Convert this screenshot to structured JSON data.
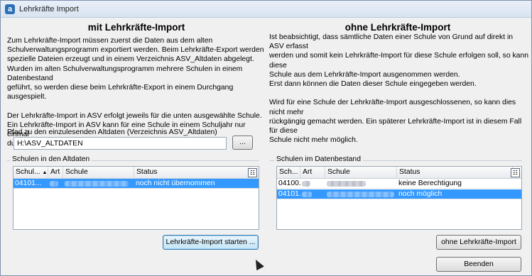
{
  "window": {
    "title": "Lehrkräfte Import",
    "app_icon": "a"
  },
  "left": {
    "heading": "mit Lehrkräfte-Import",
    "description": "Zum Lehrkräfte-Import müssen zuerst die Daten aus dem alten\nSchulverwaltungsprogramm exportiert werden. Beim Lehrkräfte-Export werden\nspezielle Dateien erzeugt und in einem Verzeichnis ASV_Altdaten abgelegt.\nWurden im alten Schulverwaltungsprogramm mehrere Schulen in einem Datenbestand\ngeführt, so werden diese beim Lehrkräfte-Export in einem Durchgang ausgespielt.\n\nDer Lehrkräfte-Import in ASV erfolgt jeweils für die unten ausgewählte Schule.\nEin Lehrkräfte-Import in ASV kann für eine Schule in einem Schuljahr nur einmal\ndurchgeführt werden.",
    "path_label": "Pfad zu den einzulesenden Altdaten (Verzeichnis ASV_Altdaten)",
    "path_value": "H:\\ASV_ALTDATEN",
    "browse_label": "...",
    "group_label": "Schulen in den Altdaten",
    "columns": [
      "Schul...",
      "Art",
      "Schule",
      "Status"
    ],
    "rows": [
      {
        "nr": "04101...",
        "art": "",
        "schule": "",
        "status": "noch nicht übernommen",
        "selected": true
      }
    ],
    "start_button": "Lehrkräfte-Import starten ..."
  },
  "right": {
    "heading": "ohne Lehrkräfte-Import",
    "description": "Ist beabsichtigt, dass sämtliche Daten einer Schule von Grund auf direkt in ASV erfasst\nwerden und somit kein Lehrkräfte-Import für diese Schule erfolgen soll, so kann diese\nSchule aus dem Lehrkräfte-Import ausgenommen werden.\nErst dann können die Daten dieser Schule eingegeben werden.\n\nWird für eine Schule der Lehrkräfte-Import ausgeschlossenen, so kann dies nicht mehr\nrückgängig gemacht werden. Ein späterer Lehrkräfte-Import ist in diesem Fall für diese\nSchule nicht mehr möglich.",
    "group_label": "Schulen im Datenbestand",
    "columns": [
      "Sch...",
      "Art",
      "Schule",
      "Status"
    ],
    "rows": [
      {
        "nr": "04100...",
        "art": "",
        "schule": "",
        "status": "keine Berechtigung",
        "selected": false
      },
      {
        "nr": "04101...",
        "art": "",
        "schule": "",
        "status": "noch möglich",
        "selected": true
      }
    ],
    "without_button": "ohne Lehrkräfte-Import"
  },
  "footer": {
    "close_button": "Beenden"
  },
  "colors": {
    "selection": "#3399ff",
    "title_bg": "#dde7f2"
  }
}
